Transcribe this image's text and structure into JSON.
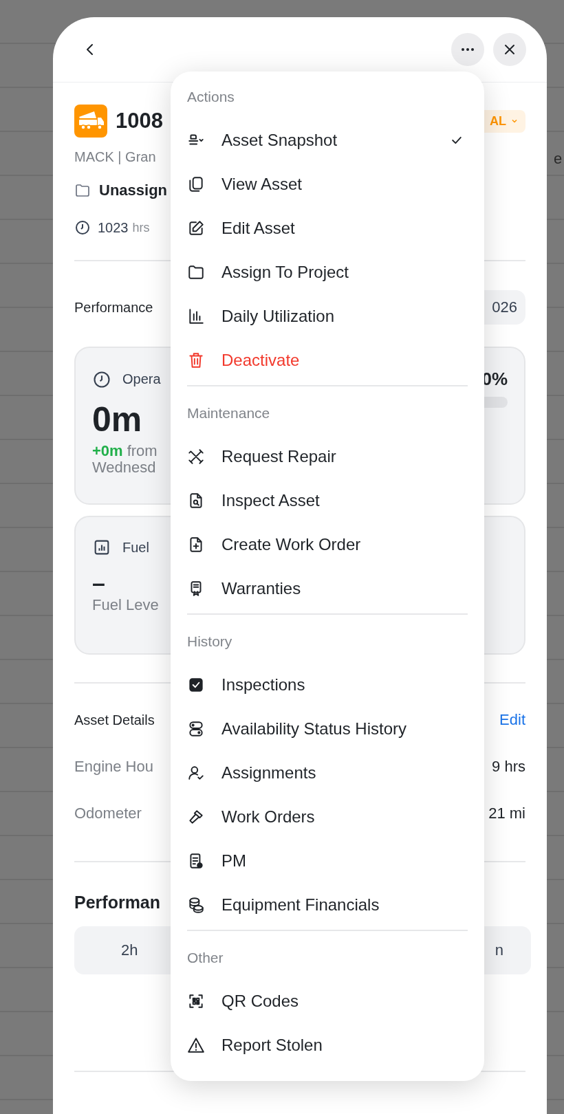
{
  "backdrop_text": "e",
  "asset": {
    "title": "1008",
    "status": "AL",
    "subtitle": "MACK | Gran",
    "project": "Unassign",
    "hours": "1023",
    "hours_unit": "hrs"
  },
  "performance_bar": {
    "label": "Performance",
    "date": "026"
  },
  "operating_card": {
    "label": "Opera",
    "value": "0m",
    "delta": "+0m",
    "delta_text": "from",
    "period": "Wednesd",
    "percent": "0%"
  },
  "fuel_card": {
    "label": "Fuel",
    "value": "–",
    "footer": "Fuel Leve"
  },
  "asset_details": {
    "title": "Asset Details",
    "edit": "Edit",
    "rows": [
      {
        "label": "Engine Hou",
        "value": "9 hrs"
      },
      {
        "label": "Odometer",
        "value": "21 mi"
      }
    ]
  },
  "performance_section": {
    "title": "Performan",
    "segments": [
      "2h",
      "n"
    ]
  },
  "menu": {
    "sections": [
      {
        "heading": "Actions",
        "items": [
          {
            "label": "Asset Snapshot",
            "selected": true,
            "destructive": false
          },
          {
            "label": "View Asset",
            "selected": false,
            "destructive": false
          },
          {
            "label": "Edit Asset",
            "selected": false,
            "destructive": false
          },
          {
            "label": "Assign To Project",
            "selected": false,
            "destructive": false
          },
          {
            "label": "Daily Utilization",
            "selected": false,
            "destructive": false
          },
          {
            "label": "Deactivate",
            "selected": false,
            "destructive": true
          }
        ]
      },
      {
        "heading": "Maintenance",
        "items": [
          {
            "label": "Request Repair",
            "selected": false,
            "destructive": false
          },
          {
            "label": "Inspect Asset",
            "selected": false,
            "destructive": false
          },
          {
            "label": "Create Work Order",
            "selected": false,
            "destructive": false
          },
          {
            "label": "Warranties",
            "selected": false,
            "destructive": false
          }
        ]
      },
      {
        "heading": "History",
        "items": [
          {
            "label": "Inspections",
            "selected": false,
            "destructive": false
          },
          {
            "label": "Availability Status History",
            "selected": false,
            "destructive": false
          },
          {
            "label": "Assignments",
            "selected": false,
            "destructive": false
          },
          {
            "label": "Work Orders",
            "selected": false,
            "destructive": false
          },
          {
            "label": "PM",
            "selected": false,
            "destructive": false
          },
          {
            "label": "Equipment Financials",
            "selected": false,
            "destructive": false
          }
        ]
      },
      {
        "heading": "Other",
        "items": [
          {
            "label": "QR Codes",
            "selected": false,
            "destructive": false
          },
          {
            "label": "Report Stolen",
            "selected": false,
            "destructive": false
          }
        ]
      }
    ]
  }
}
